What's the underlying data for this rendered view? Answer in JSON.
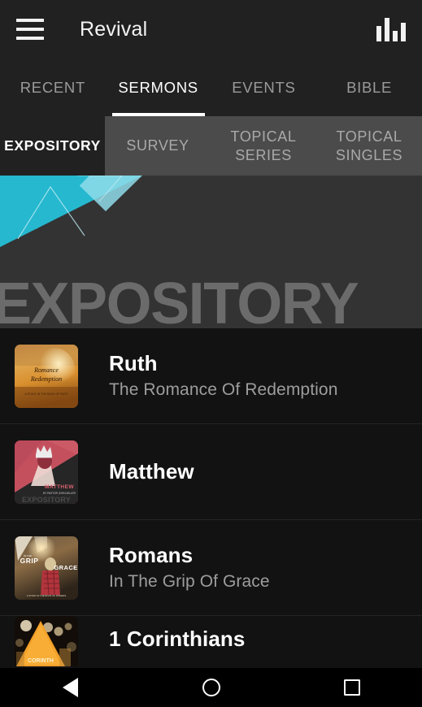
{
  "appbar": {
    "menu_icon": "hamburger-menu-icon",
    "title": "Revival",
    "action_icon": "equalizer-bars-icon"
  },
  "tabs": [
    {
      "label": "RECENT",
      "active": false
    },
    {
      "label": "SERMONS",
      "active": true
    },
    {
      "label": "EVENTS",
      "active": false
    },
    {
      "label": "BIBLE",
      "active": false
    }
  ],
  "subtabs": [
    {
      "label": "EXPOSITORY",
      "active": true
    },
    {
      "label": "SURVEY",
      "active": false
    },
    {
      "label": "TOPICAL SERIES",
      "line1": "TOPICAL",
      "line2": "SERIES",
      "active": false
    },
    {
      "label": "TOPICAL SINGLES",
      "line1": "TOPICAL",
      "line2": "SINGLES",
      "active": false
    }
  ],
  "hero": {
    "title": "EXPOSITORY",
    "background_color": "#333333",
    "accent_color": "#25b8cf",
    "accent_light_color": "#8fdcea",
    "title_color": "#6b6b6b"
  },
  "list": [
    {
      "title": "Ruth",
      "subtitle": "The Romance Of Redemption",
      "thumbnail": "wheat-field-sunset-artwork"
    },
    {
      "title": "Matthew",
      "subtitle": "",
      "thumbnail": "red-crown-king-artwork"
    },
    {
      "title": "Romans",
      "subtitle": "In The Grip Of Grace",
      "thumbnail": "climber-sunlight-artwork"
    },
    {
      "title": "1 Corinthians",
      "subtitle": "",
      "thumbnail": "orange-triangle-bokeh-artwork"
    }
  ],
  "navbar": {
    "back": "back-triangle-icon",
    "home": "home-circle-icon",
    "recents": "recents-square-icon"
  }
}
